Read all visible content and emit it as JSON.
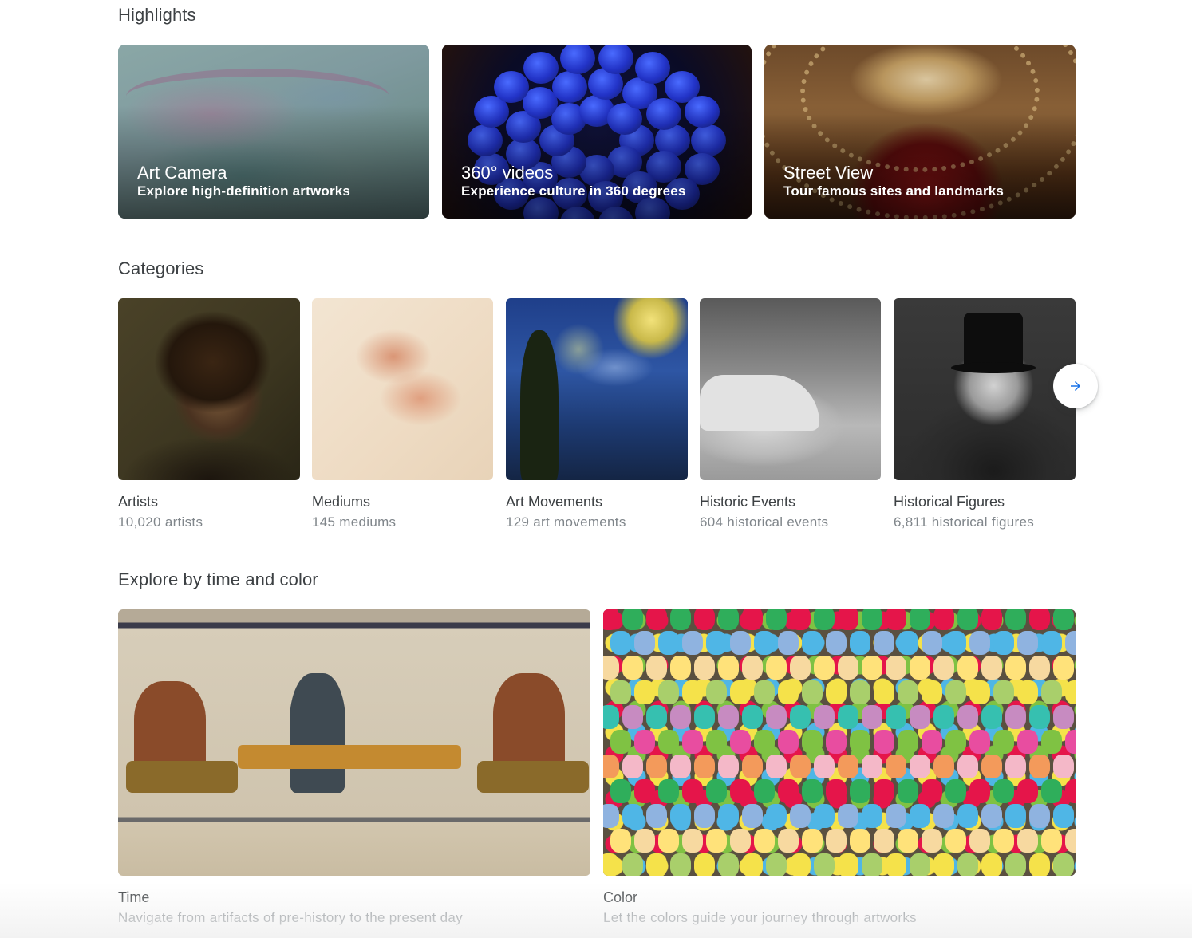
{
  "sections": {
    "highlights": "Highlights",
    "categories": "Categories",
    "explore": "Explore by time and color"
  },
  "highlights": [
    {
      "title": "Art Camera",
      "subtitle": "Explore high-definition artworks"
    },
    {
      "title": "360° videos",
      "subtitle": "Experience culture in 360 degrees"
    },
    {
      "title": "Street View",
      "subtitle": "Tour famous sites and landmarks"
    }
  ],
  "categories": [
    {
      "name": "Artists",
      "count": "10,020 artists"
    },
    {
      "name": "Mediums",
      "count": "145 mediums"
    },
    {
      "name": "Art Movements",
      "count": "129 art movements"
    },
    {
      "name": "Historic Events",
      "count": "604 historical events"
    },
    {
      "name": "Historical Figures",
      "count": "6,811 historical figures"
    }
  ],
  "explore": [
    {
      "name": "Time",
      "desc": "Navigate from artifacts of pre-history to the present day"
    },
    {
      "name": "Color",
      "desc": "Let the colors guide your journey through artworks"
    }
  ],
  "icons": {
    "next": "arrow-right-icon"
  },
  "colors": {
    "accent": "#1a73e8"
  }
}
